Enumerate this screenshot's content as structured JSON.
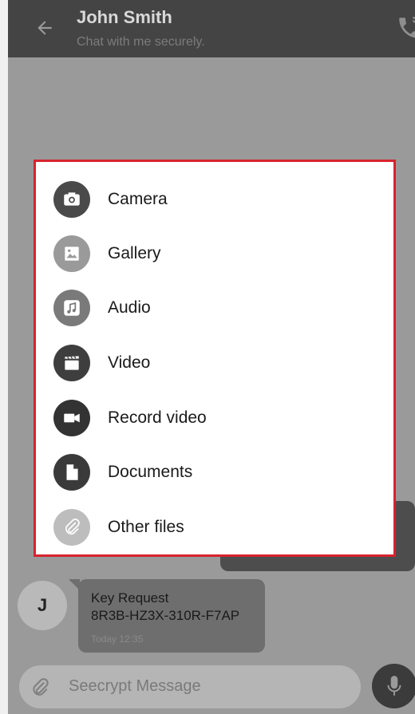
{
  "header": {
    "contact_name": "John Smith",
    "status": "Chat with me securely."
  },
  "attach_menu": {
    "items": [
      {
        "label": "Camera",
        "icon": "camera-icon",
        "color": "#4a4a4a"
      },
      {
        "label": "Gallery",
        "icon": "gallery-icon",
        "color": "#9a9a9a"
      },
      {
        "label": "Audio",
        "icon": "audio-icon",
        "color": "#7a7a7a"
      },
      {
        "label": "Video",
        "icon": "video-icon",
        "color": "#3e3e3e"
      },
      {
        "label": "Record video",
        "icon": "record-video-icon",
        "color": "#333333"
      },
      {
        "label": "Documents",
        "icon": "documents-icon",
        "color": "#3a3a3a"
      },
      {
        "label": "Other files",
        "icon": "other-files-icon",
        "color": "#bdbdbd"
      }
    ],
    "highlight_color": "#d7232e"
  },
  "message": {
    "avatar_initial": "J",
    "title": "Key Request",
    "code": "8R3B-HZ3X-310R-F7AP",
    "time": "Today 12:35"
  },
  "composer": {
    "placeholder": "Seecrypt Message"
  }
}
